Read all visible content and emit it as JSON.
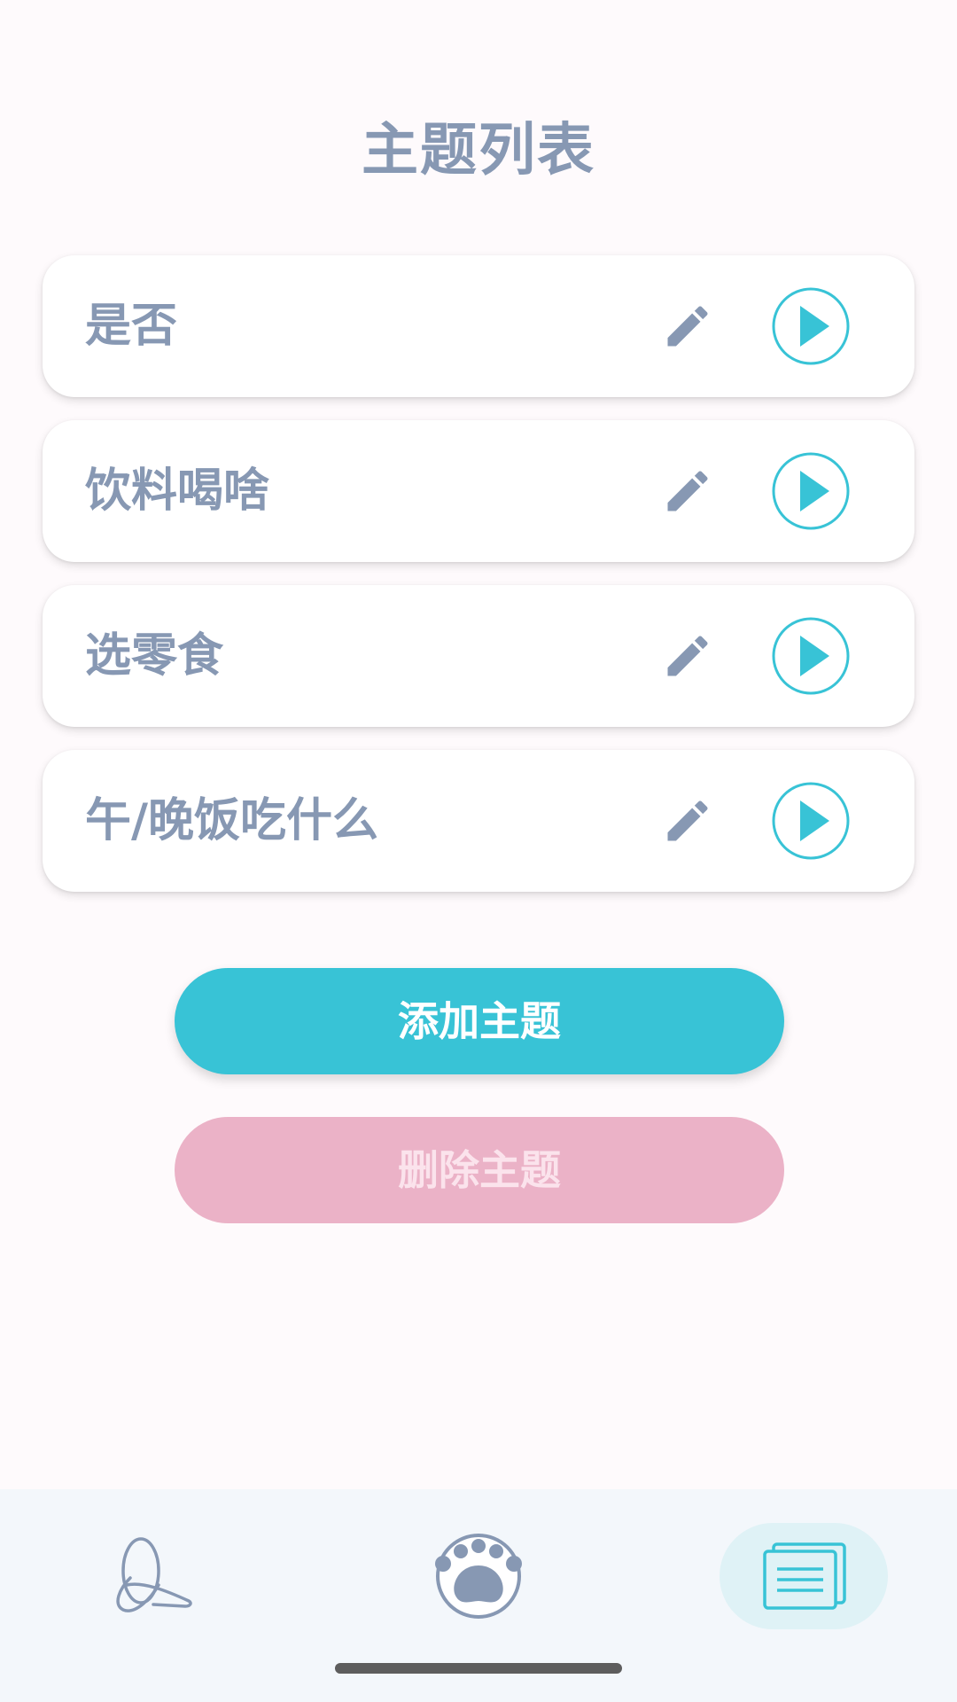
{
  "header": {
    "title": "主题列表"
  },
  "topics": [
    {
      "name": "是否"
    },
    {
      "name": "饮料喝啥"
    },
    {
      "name": "选零食"
    },
    {
      "name": "午/晚饭吃什么"
    }
  ],
  "actions": {
    "add_label": "添加主题",
    "delete_label": "删除主题"
  },
  "nav": {
    "items": [
      {
        "icon": "knot-icon",
        "active": false
      },
      {
        "icon": "paw-icon",
        "active": false
      },
      {
        "icon": "cards-icon",
        "active": true
      }
    ]
  },
  "colors": {
    "title": "#8798b3",
    "accent": "#38c3d6",
    "delete": "#ebb2c7",
    "background": "#fefafc"
  }
}
